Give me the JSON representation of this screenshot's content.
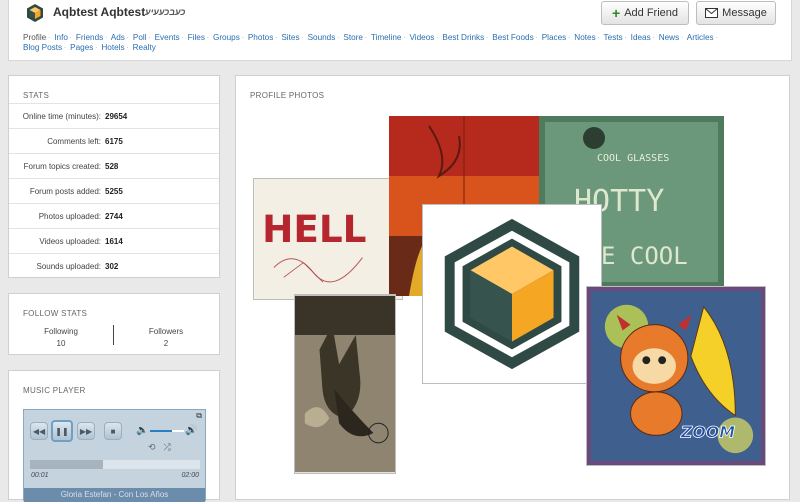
{
  "header": {
    "name": "Aqbtest Aqbtest",
    "alt_name": "כעבכעעיע",
    "add_friend_label": "Add Friend",
    "message_label": "Message"
  },
  "nav": [
    "Profile",
    "Info",
    "Friends",
    "Ads",
    "Poll",
    "Events",
    "Files",
    "Groups",
    "Photos",
    "Sites",
    "Sounds",
    "Store",
    "Timeline",
    "Videos",
    "Best Drinks",
    "Best Foods",
    "Places",
    "Notes",
    "Tests",
    "Ideas",
    "News",
    "Articles",
    "Blog Posts",
    "Pages",
    "Hotels",
    "Realty"
  ],
  "stats": {
    "title": "STATS",
    "rows": [
      {
        "label": "Online time (minutes):",
        "value": "29654"
      },
      {
        "label": "Comments left:",
        "value": "6175"
      },
      {
        "label": "Forum topics created:",
        "value": "528"
      },
      {
        "label": "Forum posts added:",
        "value": "5255"
      },
      {
        "label": "Photos uploaded:",
        "value": "2744"
      },
      {
        "label": "Videos uploaded:",
        "value": "1614"
      },
      {
        "label": "Sounds uploaded:",
        "value": "302"
      }
    ]
  },
  "follow": {
    "title": "FOLLOW STATS",
    "following_label": "Following",
    "following_value": "10",
    "followers_label": "Followers",
    "followers_value": "2"
  },
  "music": {
    "title": "MUSIC PLAYER",
    "current_time": "00:01",
    "duration": "02:00",
    "progress": 0.43,
    "volume": 0.65,
    "track": "Gloria Estefan - Con Los Años"
  },
  "photos": {
    "title": "PROFILE PHOTOS",
    "hello_text": "HELL",
    "cool_glasses_text": "COOL GLASSES",
    "hotty_text": "HOTTY",
    "be_cool_text": "E COOL",
    "zoom_text": "ZOOM"
  },
  "colors": {
    "link": "#2a6fb0",
    "logo_orange": "#f5a623",
    "logo_dark": "#2f4a44"
  }
}
